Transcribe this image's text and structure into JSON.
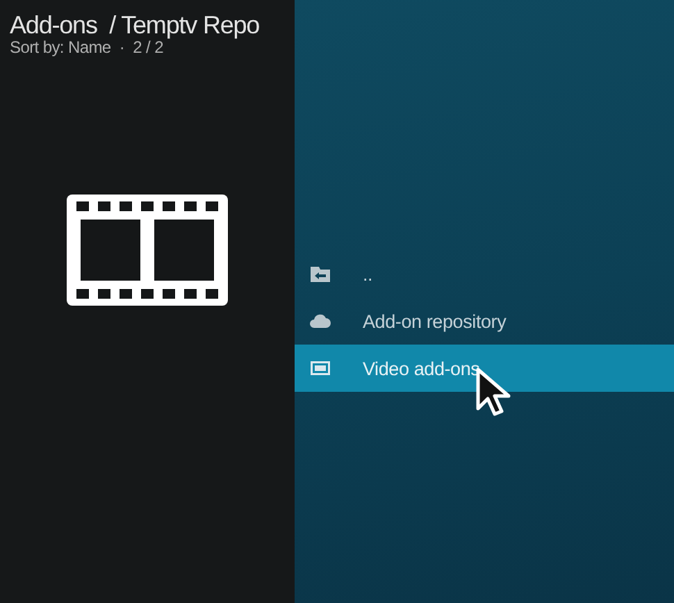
{
  "header": {
    "title": "Add-ons  / Temptv Repo",
    "subtitle": "Sort by: Name  ·  2 / 2"
  },
  "items": [
    {
      "label": "..",
      "kind": "back",
      "selected": false
    },
    {
      "label": "Add-on repository",
      "kind": "cloud",
      "selected": false
    },
    {
      "label": "Video add-ons",
      "kind": "video",
      "selected": true
    }
  ]
}
